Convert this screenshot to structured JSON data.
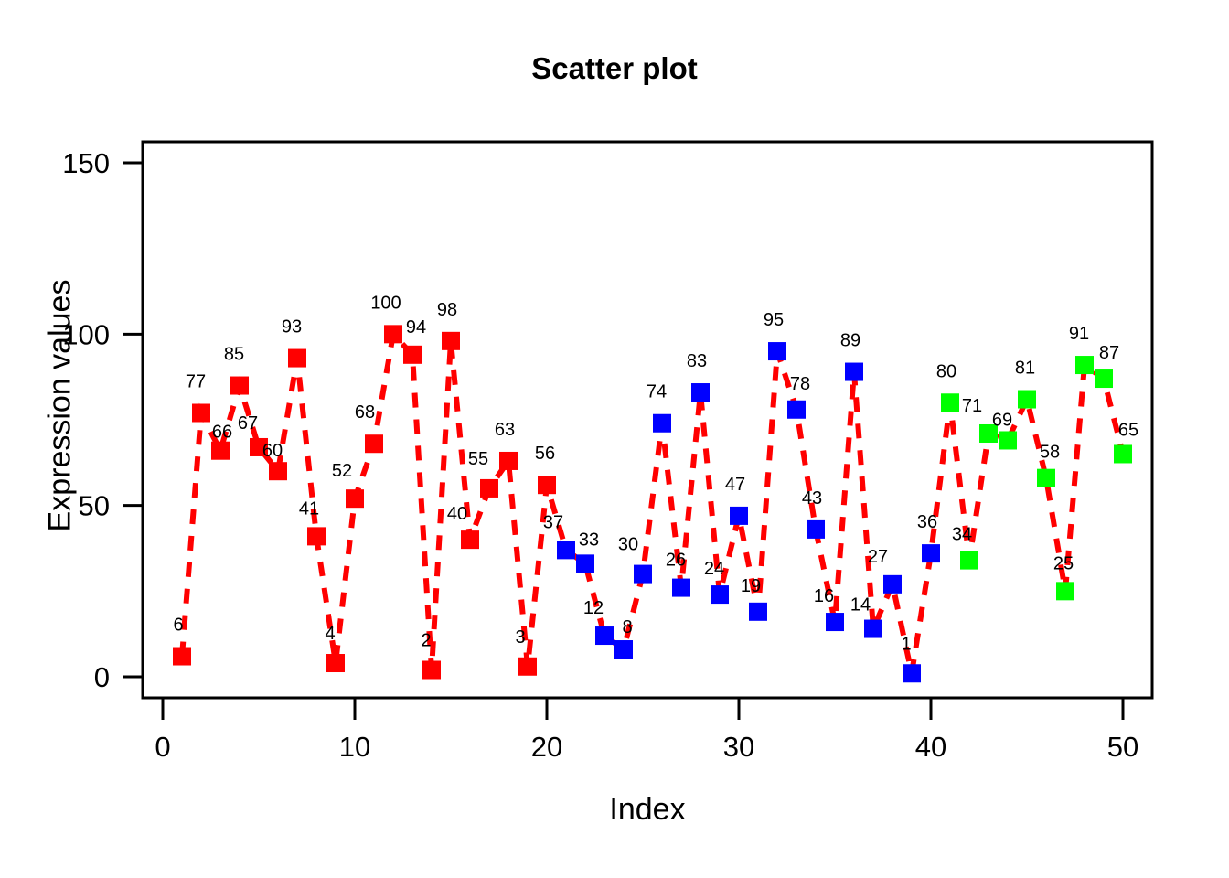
{
  "chart_data": {
    "type": "scatter",
    "title": "Scatter plot",
    "xlabel": "Index",
    "ylabel": "Expression values",
    "xlim": [
      0,
      51
    ],
    "ylim": [
      0,
      155
    ],
    "xticks": [
      0,
      10,
      20,
      30,
      40,
      50
    ],
    "yticks": [
      0,
      50,
      100,
      150
    ],
    "grid": false,
    "legend": null,
    "marker": "filled-square",
    "line_style": "dashed",
    "line_color": "#FF0000",
    "group_colors": {
      "group1": "#FF0000",
      "group2": "#0000FF",
      "group3": "#00FF00"
    },
    "x": [
      1,
      2,
      3,
      4,
      5,
      6,
      7,
      8,
      9,
      10,
      11,
      12,
      13,
      14,
      15,
      16,
      17,
      18,
      19,
      20,
      21,
      22,
      23,
      24,
      25,
      26,
      27,
      28,
      29,
      30,
      31,
      32,
      33,
      34,
      35,
      36,
      37,
      38,
      39,
      40,
      41,
      42,
      43,
      44,
      45,
      46,
      47,
      48,
      49,
      50
    ],
    "values": [
      6,
      77,
      66,
      85,
      67,
      60,
      93,
      41,
      4,
      52,
      68,
      100,
      94,
      2,
      98,
      40,
      55,
      63,
      3,
      56,
      37,
      33,
      12,
      8,
      30,
      74,
      26,
      83,
      24,
      47,
      19,
      95,
      78,
      43,
      16,
      89,
      14,
      27,
      1,
      36,
      80,
      34,
      71,
      69,
      81,
      58,
      25,
      91,
      87,
      65
    ],
    "labels": [
      "6",
      "77",
      "66",
      "85",
      "67",
      "60",
      "93",
      "41",
      "4",
      "52",
      "68",
      "100",
      "94",
      "2",
      "98",
      "40",
      "55",
      "63",
      "3",
      "56",
      "37",
      "33",
      "12",
      "8",
      "30",
      "74",
      "26",
      "83",
      "24",
      "47",
      "19",
      "95",
      "78",
      "43",
      "16",
      "89",
      "14",
      "27",
      "1",
      "36",
      "80",
      "34",
      "71",
      "69",
      "81",
      "58",
      "25",
      "91",
      "87",
      "65"
    ],
    "colors": [
      "#FF0000",
      "#FF0000",
      "#FF0000",
      "#FF0000",
      "#FF0000",
      "#FF0000",
      "#FF0000",
      "#FF0000",
      "#FF0000",
      "#FF0000",
      "#FF0000",
      "#FF0000",
      "#FF0000",
      "#FF0000",
      "#FF0000",
      "#FF0000",
      "#FF0000",
      "#FF0000",
      "#FF0000",
      "#FF0000",
      "#0000FF",
      "#0000FF",
      "#0000FF",
      "#0000FF",
      "#0000FF",
      "#0000FF",
      "#0000FF",
      "#0000FF",
      "#0000FF",
      "#0000FF",
      "#0000FF",
      "#0000FF",
      "#0000FF",
      "#0000FF",
      "#0000FF",
      "#0000FF",
      "#0000FF",
      "#0000FF",
      "#0000FF",
      "#0000FF",
      "#00FF00",
      "#00FF00",
      "#00FF00",
      "#00FF00",
      "#00FF00",
      "#00FF00",
      "#00FF00",
      "#00FF00",
      "#00FF00",
      "#00FF00"
    ],
    "label_offsets": [
      [
        -4,
        -16
      ],
      [
        -6,
        -16
      ],
      [
        2,
        -2
      ],
      [
        -6,
        -16
      ],
      [
        -12,
        -8
      ],
      [
        -6,
        -4
      ],
      [
        -6,
        -16
      ],
      [
        -8,
        -12
      ],
      [
        -6,
        -14
      ],
      [
        -14,
        -12
      ],
      [
        -10,
        -16
      ],
      [
        -8,
        -16
      ],
      [
        4,
        -12
      ],
      [
        -6,
        -14
      ],
      [
        -4,
        -16
      ],
      [
        -14,
        -10
      ],
      [
        -12,
        -14
      ],
      [
        -4,
        -16
      ],
      [
        -8,
        -14
      ],
      [
        -2,
        -16
      ],
      [
        -14,
        -12
      ],
      [
        4,
        -8
      ],
      [
        -12,
        -12
      ],
      [
        4,
        -6
      ],
      [
        -16,
        -14
      ],
      [
        -6,
        -16
      ],
      [
        -6,
        -12
      ],
      [
        -4,
        -16
      ],
      [
        -6,
        -10
      ],
      [
        -4,
        -16
      ],
      [
        -8,
        -10
      ],
      [
        -4,
        -16
      ],
      [
        4,
        -10
      ],
      [
        -4,
        -16
      ],
      [
        -12,
        -10
      ],
      [
        -4,
        -16
      ],
      [
        -14,
        -8
      ],
      [
        -16,
        -12
      ],
      [
        -6,
        -14
      ],
      [
        -4,
        -16
      ],
      [
        -4,
        -16
      ],
      [
        -8,
        -10
      ],
      [
        -18,
        -12
      ],
      [
        -6,
        -4
      ],
      [
        -2,
        -16
      ],
      [
        4,
        -10
      ],
      [
        -2,
        -12
      ],
      [
        -6,
        -16
      ],
      [
        6,
        -10
      ],
      [
        6,
        -8
      ]
    ]
  }
}
